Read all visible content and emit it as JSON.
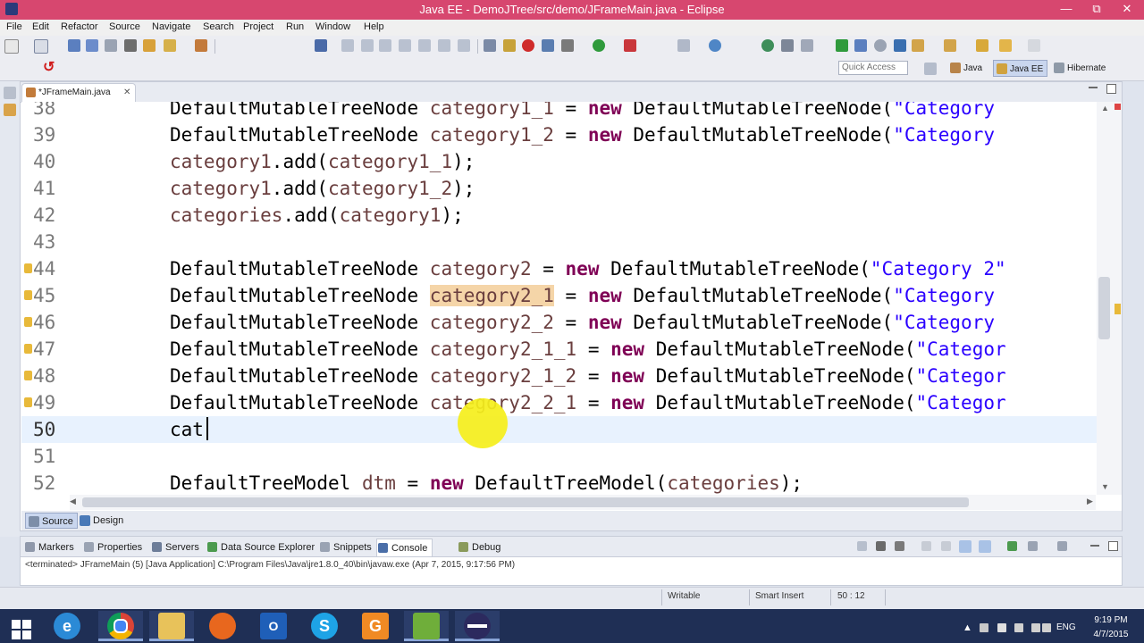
{
  "window": {
    "title": "Java EE - DemoJTree/src/demo/JFrameMain.java - Eclipse",
    "minimize": "—",
    "maximize": "⧉",
    "close": "✕"
  },
  "menu": [
    "File",
    "Edit",
    "Refactor",
    "Source",
    "Navigate",
    "Search",
    "Project",
    "Run",
    "Window",
    "Help"
  ],
  "toolbar": {
    "quick_access_placeholder": "Quick Access",
    "perspectives": [
      "Java",
      "Java EE",
      "Hibernate"
    ],
    "active_perspective": "Java EE"
  },
  "editor": {
    "tab_label": "*JFrameMain.java",
    "tab_close": "✕",
    "lines": [
      {
        "n": "38",
        "parts": [
          [
            "t",
            "DefaultMutableTreeNode "
          ],
          [
            "v",
            "category1_1"
          ],
          [
            "t",
            " = "
          ],
          [
            "k",
            "new"
          ],
          [
            "t",
            " DefaultMutableTreeNode("
          ],
          [
            "s",
            "\"Category"
          ]
        ]
      },
      {
        "n": "39",
        "parts": [
          [
            "t",
            "DefaultMutableTreeNode "
          ],
          [
            "v",
            "category1_2"
          ],
          [
            "t",
            " = "
          ],
          [
            "k",
            "new"
          ],
          [
            "t",
            " DefaultMutableTreeNode("
          ],
          [
            "s",
            "\"Category"
          ]
        ]
      },
      {
        "n": "40",
        "parts": [
          [
            "v",
            "category1"
          ],
          [
            "t",
            ".add("
          ],
          [
            "v",
            "category1_1"
          ],
          [
            "t",
            ");"
          ]
        ]
      },
      {
        "n": "41",
        "parts": [
          [
            "v",
            "category1"
          ],
          [
            "t",
            ".add("
          ],
          [
            "v",
            "category1_2"
          ],
          [
            "t",
            ");"
          ]
        ]
      },
      {
        "n": "42",
        "parts": [
          [
            "v",
            "categories"
          ],
          [
            "t",
            ".add("
          ],
          [
            "v",
            "category1"
          ],
          [
            "t",
            ");"
          ]
        ]
      },
      {
        "n": "43",
        "parts": []
      },
      {
        "n": "44",
        "warn": true,
        "parts": [
          [
            "t",
            "DefaultMutableTreeNode "
          ],
          [
            "v",
            "category2"
          ],
          [
            "t",
            " = "
          ],
          [
            "k",
            "new"
          ],
          [
            "t",
            " DefaultMutableTreeNode("
          ],
          [
            "s",
            "\"Category 2\""
          ]
        ]
      },
      {
        "n": "45",
        "warn": true,
        "parts": [
          [
            "t",
            "DefaultMutableTreeNode "
          ],
          [
            "o",
            "category2_1"
          ],
          [
            "t",
            " = "
          ],
          [
            "k",
            "new"
          ],
          [
            "t",
            " DefaultMutableTreeNode("
          ],
          [
            "s",
            "\"Category"
          ]
        ]
      },
      {
        "n": "46",
        "warn": true,
        "parts": [
          [
            "t",
            "DefaultMutableTreeNode "
          ],
          [
            "v",
            "category2_2"
          ],
          [
            "t",
            " = "
          ],
          [
            "k",
            "new"
          ],
          [
            "t",
            " DefaultMutableTreeNode("
          ],
          [
            "s",
            "\"Category"
          ]
        ]
      },
      {
        "n": "47",
        "warn": true,
        "parts": [
          [
            "t",
            "DefaultMutableTreeNode "
          ],
          [
            "v",
            "category2_1_1"
          ],
          [
            "t",
            " = "
          ],
          [
            "k",
            "new"
          ],
          [
            "t",
            " DefaultMutableTreeNode("
          ],
          [
            "s",
            "\"Categor"
          ]
        ]
      },
      {
        "n": "48",
        "warn": true,
        "parts": [
          [
            "t",
            "DefaultMutableTreeNode "
          ],
          [
            "v",
            "category2_1_2"
          ],
          [
            "t",
            " = "
          ],
          [
            "k",
            "new"
          ],
          [
            "t",
            " DefaultMutableTreeNode("
          ],
          [
            "s",
            "\"Categor"
          ]
        ]
      },
      {
        "n": "49",
        "warn": true,
        "parts": [
          [
            "t",
            "DefaultMutableTreeNode "
          ],
          [
            "v",
            "category2_2_1"
          ],
          [
            "t",
            " = "
          ],
          [
            "k",
            "new"
          ],
          [
            "t",
            " DefaultMutableTreeNode("
          ],
          [
            "s",
            "\"Categor"
          ]
        ]
      },
      {
        "n": "50",
        "current": true,
        "parts": [
          [
            "t",
            "cat"
          ]
        ]
      },
      {
        "n": "51",
        "parts": []
      },
      {
        "n": "52",
        "parts": [
          [
            "t",
            "DefaultTreeModel "
          ],
          [
            "v",
            "dtm"
          ],
          [
            "t",
            " = "
          ],
          [
            "k",
            "new"
          ],
          [
            "t",
            " DefaultTreeModel("
          ],
          [
            "v",
            "categories"
          ],
          [
            "t",
            ");"
          ]
        ]
      }
    ],
    "subtabs": [
      "Source",
      "Design"
    ],
    "active_subtab": "Source"
  },
  "bottom_panel": {
    "tabs": [
      "Markers",
      "Properties",
      "Servers",
      "Data Source Explorer",
      "Snippets",
      "Console",
      "Debug"
    ],
    "active_tab": "Console",
    "console_text": "<terminated> JFrameMain (5) [Java Application] C:\\Program Files\\Java\\jre1.8.0_40\\bin\\javaw.exe (Apr 7, 2015, 9:17:56 PM)"
  },
  "status_bar": {
    "mode": "Writable",
    "insert": "Smart Insert",
    "position": "50 : 12"
  },
  "taskbar": {
    "apps": [
      "start-button",
      "internet-explorer",
      "chrome",
      "file-explorer",
      "firefox",
      "outlook",
      "skype",
      "app-g",
      "photo-app",
      "eclipse"
    ],
    "time": "9:19 PM",
    "date": "4/7/2015",
    "language": "ENG"
  },
  "colors": {
    "title_bar": "#d7476f",
    "keyword": "#7f0055",
    "string": "#2a00ff",
    "local_var": "#6a3e3e",
    "occurrence": "#f5d5a8",
    "current_line": "#e8f2fe",
    "taskbar": "#1f2f55"
  }
}
